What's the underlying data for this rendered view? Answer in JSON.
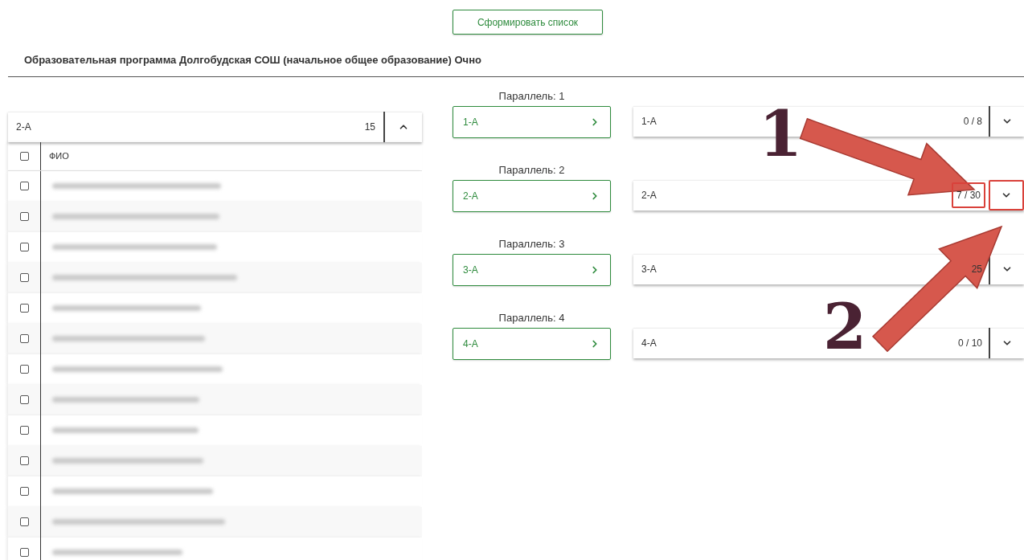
{
  "form_button": "Сформировать список",
  "program_title": "Образовательная программа Долгобудская СОШ (начальное общее образование) Очно",
  "source_class": {
    "name": "2-А",
    "count": "15",
    "expanded": true
  },
  "table": {
    "columns": [
      "ФИО"
    ],
    "header_checked": false,
    "rows": [
      {
        "checked": false
      },
      {
        "checked": false
      },
      {
        "checked": false
      },
      {
        "checked": false
      },
      {
        "checked": false
      },
      {
        "checked": false
      },
      {
        "checked": false
      },
      {
        "checked": false
      },
      {
        "checked": false
      },
      {
        "checked": false
      },
      {
        "checked": false
      },
      {
        "checked": false
      },
      {
        "checked": false
      }
    ]
  },
  "parallels": [
    {
      "label": "Параллель: 1",
      "class_button": "1-А",
      "target": {
        "name": "1-А",
        "count": "0 / 8",
        "expanded": false,
        "highlighted": false
      }
    },
    {
      "label": "Параллель: 2",
      "class_button": "2-А",
      "target": {
        "name": "2-А",
        "count": "7 / 30",
        "expanded": false,
        "highlighted": true
      }
    },
    {
      "label": "Параллель: 3",
      "class_button": "3-А",
      "target": {
        "name": "3-А",
        "count": "25",
        "expanded": false,
        "highlighted": false
      }
    },
    {
      "label": "Параллель: 4",
      "class_button": "4-А",
      "target": {
        "name": "4-А",
        "count": "0 / 10",
        "expanded": false,
        "highlighted": false
      }
    }
  ],
  "annotations": [
    {
      "label": "1"
    },
    {
      "label": "2"
    }
  ]
}
